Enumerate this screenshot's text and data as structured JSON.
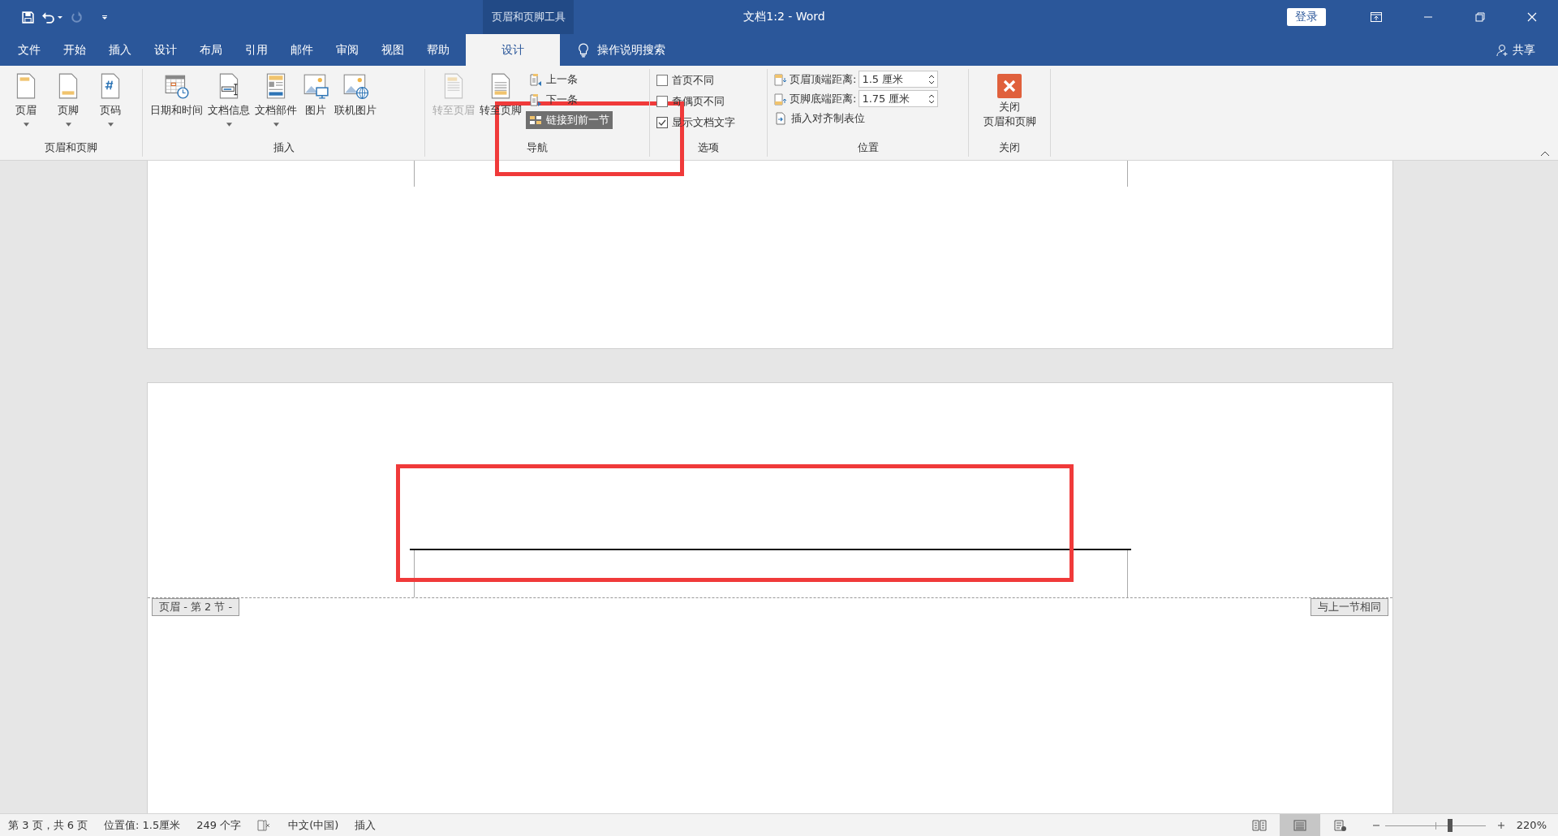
{
  "window": {
    "title": "文档1:2  -  Word",
    "contextual_group": "页眉和页脚工具",
    "sign_in": "登录",
    "share": "共享"
  },
  "menu_tabs": [
    {
      "label": "文件",
      "selected": false
    },
    {
      "label": "开始",
      "selected": false
    },
    {
      "label": "插入",
      "selected": false
    },
    {
      "label": "设计",
      "selected": false
    },
    {
      "label": "布局",
      "selected": false
    },
    {
      "label": "引用",
      "selected": false
    },
    {
      "label": "邮件",
      "selected": false
    },
    {
      "label": "审阅",
      "selected": false
    },
    {
      "label": "视图",
      "selected": false
    },
    {
      "label": "帮助",
      "selected": false
    },
    {
      "label": "设计",
      "selected": true
    }
  ],
  "tell_me": {
    "placeholder": "操作说明搜索"
  },
  "ribbon_groups": [
    {
      "label": "页眉和页脚",
      "items": [
        {
          "kind": "large",
          "label": "页眉",
          "dropdown": true,
          "disabled": false
        },
        {
          "kind": "large",
          "label": "页脚",
          "dropdown": true,
          "disabled": false
        },
        {
          "kind": "large",
          "label": "页码",
          "dropdown": true,
          "disabled": false
        }
      ]
    },
    {
      "label": "插入",
      "items": [
        {
          "kind": "large",
          "label": "日期和时间",
          "dropdown": false,
          "disabled": false
        },
        {
          "kind": "large",
          "label": "文档信息",
          "dropdown": true,
          "disabled": false
        },
        {
          "kind": "large",
          "label": "文档部件",
          "dropdown": true,
          "disabled": false
        },
        {
          "kind": "large",
          "label": "图片",
          "dropdown": false,
          "disabled": false
        },
        {
          "kind": "large",
          "label": "联机图片",
          "dropdown": false,
          "disabled": false
        }
      ]
    },
    {
      "label": "导航",
      "items": [
        {
          "kind": "large",
          "label": "转至页眉",
          "dropdown": false,
          "disabled": true
        },
        {
          "kind": "large",
          "label": "转至页脚",
          "dropdown": false,
          "disabled": false
        },
        {
          "kind": "small",
          "label": "上一条",
          "highlighted": false
        },
        {
          "kind": "small",
          "label": "下一条",
          "highlighted": false
        },
        {
          "kind": "small",
          "label": "链接到前一节",
          "highlighted": true
        }
      ]
    },
    {
      "label": "选项",
      "items": [
        {
          "kind": "checkbox",
          "label": "首页不同",
          "checked": false
        },
        {
          "kind": "checkbox",
          "label": "奇偶页不同",
          "checked": false
        },
        {
          "kind": "checkbox",
          "label": "显示文档文字",
          "checked": true
        }
      ]
    },
    {
      "label": "位置",
      "items": [
        {
          "kind": "spinner",
          "label": "页眉顶端距离:",
          "value": "1.5 厘米"
        },
        {
          "kind": "spinner",
          "label": "页脚底端距离:",
          "value": "1.75 厘米"
        },
        {
          "kind": "small",
          "label": "插入对齐制表位",
          "highlighted": false
        }
      ]
    },
    {
      "label": "关闭",
      "items": [
        {
          "kind": "close",
          "lines": [
            "关闭",
            "页眉和页脚"
          ]
        }
      ]
    }
  ],
  "document": {
    "header_tag": "页眉 - 第 2 节 -",
    "same_as_previous": "与上一节相同"
  },
  "status_bar": {
    "items": [
      "第 3 页，共 6 页",
      "位置值: 1.5厘米",
      "249 个字"
    ],
    "language": "中文(中国)",
    "mode": "插入",
    "views": [
      {
        "selected": false
      },
      {
        "selected": true
      },
      {
        "selected": false
      }
    ],
    "zoom": {
      "level": 0.65,
      "reading": "220%"
    }
  }
}
